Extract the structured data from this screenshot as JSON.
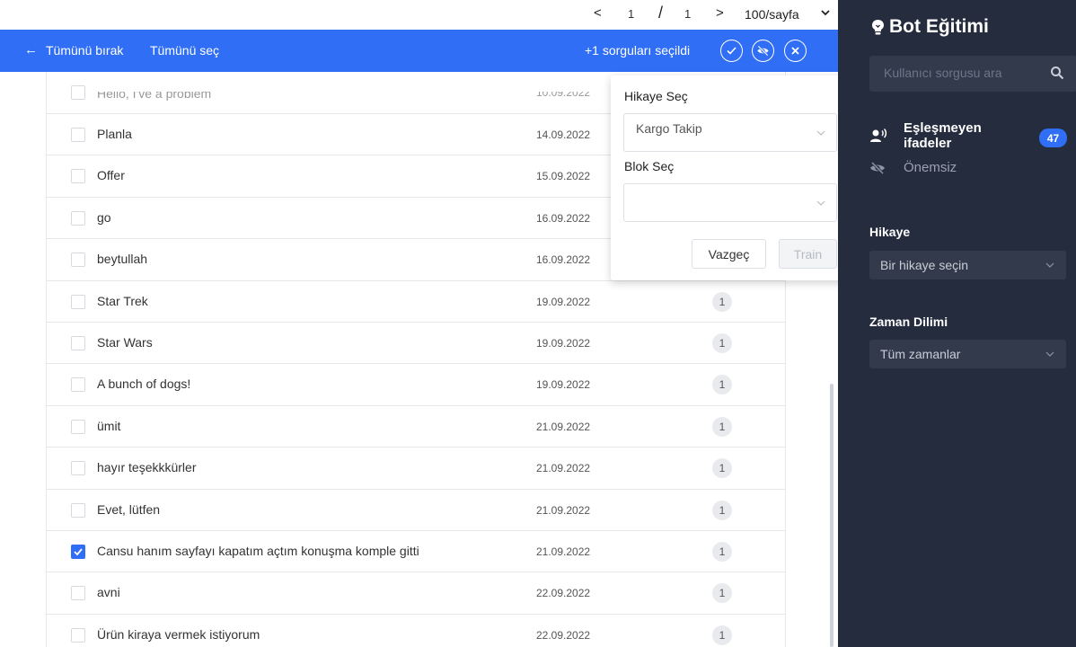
{
  "pager": {
    "prev": "<",
    "current": "1",
    "separator": "/",
    "total": "1",
    "next": ">",
    "per_page": "100/sayfa"
  },
  "bulk": {
    "back": "←",
    "deselect_all": "Tümünü bırak",
    "select_all": "Tümünü seç",
    "selected_count": "+1 sorguları seçildi"
  },
  "rows": [
    {
      "text": "Hello, I've a problem",
      "date": "10.09.2022",
      "count": "",
      "checked": false
    },
    {
      "text": "Planla",
      "date": "14.09.2022",
      "count": "",
      "checked": false
    },
    {
      "text": "Offer",
      "date": "15.09.2022",
      "count": "",
      "checked": false
    },
    {
      "text": "go",
      "date": "16.09.2022",
      "count": "",
      "checked": false
    },
    {
      "text": "beytullah",
      "date": "16.09.2022",
      "count": "",
      "checked": false
    },
    {
      "text": "Star Trek",
      "date": "19.09.2022",
      "count": "1",
      "checked": false
    },
    {
      "text": "Star Wars",
      "date": "19.09.2022",
      "count": "1",
      "checked": false
    },
    {
      "text": "A bunch of dogs!",
      "date": "19.09.2022",
      "count": "1",
      "checked": false
    },
    {
      "text": "ümit",
      "date": "21.09.2022",
      "count": "1",
      "checked": false
    },
    {
      "text": "hayır teşekkkürler",
      "date": "21.09.2022",
      "count": "1",
      "checked": false
    },
    {
      "text": "Evet, lütfen",
      "date": "21.09.2022",
      "count": "1",
      "checked": false
    },
    {
      "text": "Cansu hanım sayfayı kapatım açtım konuşma komple gitti",
      "date": "21.09.2022",
      "count": "1",
      "checked": true
    },
    {
      "text": "avni",
      "date": "22.09.2022",
      "count": "1",
      "checked": false
    },
    {
      "text": "Ürün kiraya vermek istiyorum",
      "date": "22.09.2022",
      "count": "1",
      "checked": false
    }
  ],
  "popup": {
    "story_label": "Hikaye Seç",
    "story_value": "Kargo Takip",
    "block_label": "Blok Seç",
    "block_value": "",
    "cancel": "Vazgeç",
    "train": "Train"
  },
  "sidebar": {
    "title": "Bot Eğitimi",
    "search_placeholder": "Kullanıcı sorgusu ara",
    "unmatched_label": "Eşleşmeyen ifadeler",
    "unmatched_count": "47",
    "unimportant_label": "Önemsiz",
    "story_section": "Hikaye",
    "story_dropdown": "Bir hikaye seçin",
    "time_section": "Zaman Dilimi",
    "time_dropdown": "Tüm zamanlar"
  },
  "colors": {
    "accent": "#2f6ef5",
    "sidebar_bg": "#252c3e",
    "sidebar_input": "#333a4c"
  }
}
